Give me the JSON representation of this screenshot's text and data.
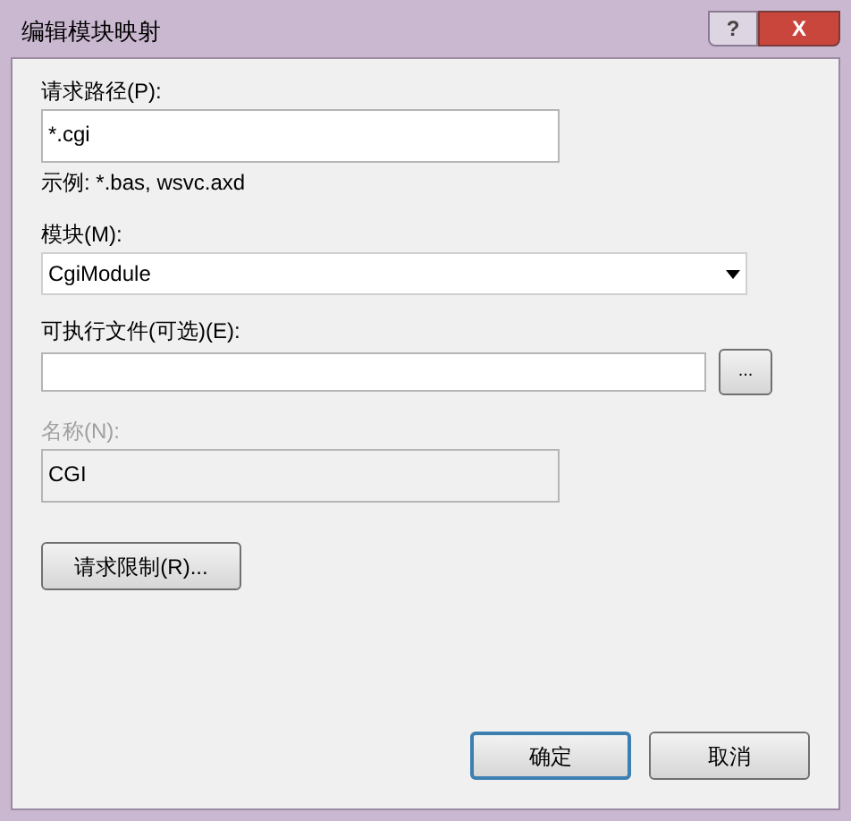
{
  "window": {
    "title": "编辑模块映射",
    "title_buttons": [
      {
        "kind": "help",
        "label": "?"
      },
      {
        "kind": "close",
        "label": "X"
      }
    ]
  },
  "fields": [
    {
      "kind": "text",
      "label": "请求路径(P):",
      "value": "*.cgi",
      "hint": "示例: *.bas, wsvc.axd",
      "disabled": false
    },
    {
      "kind": "dropdown",
      "label": "模块(M):",
      "value": "CgiModule",
      "disabled": false
    },
    {
      "kind": "browse",
      "label": "可执行文件(可选)(E):",
      "button": "...",
      "disabled": false
    },
    {
      "kind": "text",
      "label": "名称(N):",
      "value": "CGI",
      "disabled": true
    }
  ],
  "restrictions_button": "请求限制(R)...",
  "buttons": [
    {
      "label": "确定",
      "default": true
    },
    {
      "label": "取消",
      "default": false
    }
  ]
}
